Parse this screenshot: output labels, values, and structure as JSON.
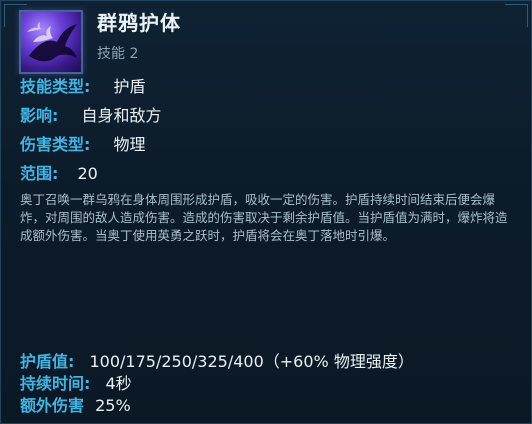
{
  "skill": {
    "name": "群鸦护体",
    "slot": "技能 2",
    "icon": "raven-icon"
  },
  "attributes": [
    {
      "label": "技能类型:",
      "value": "护盾"
    },
    {
      "label": "影响:",
      "value": "自身和敌方"
    },
    {
      "label": "伤害类型:",
      "value": "物理"
    },
    {
      "label": "范围:",
      "value": "20"
    }
  ],
  "description": "奥丁召唤一群乌鸦在身体周围形成护盾，吸收一定的伤害。护盾持续时间结束后便会爆炸，对周围的敌人造成伤害。造成的伤害取决于剩余护盾值。当护盾值为满时，爆炸将造成额外伤害。当奥丁使用英勇之跃时，护盾将会在奥丁落地时引爆。",
  "stats": [
    {
      "label": "护盾值:",
      "value": "100/175/250/325/400（+60% 物理强度）"
    },
    {
      "label": "持续时间:",
      "value": "4秒"
    },
    {
      "label": "额外伤害",
      "value": "25%"
    }
  ],
  "colors": {
    "label": "#3fb7e6",
    "value": "#eaf1f6",
    "description": "#a9bfcc",
    "background": "#0c1b29"
  }
}
